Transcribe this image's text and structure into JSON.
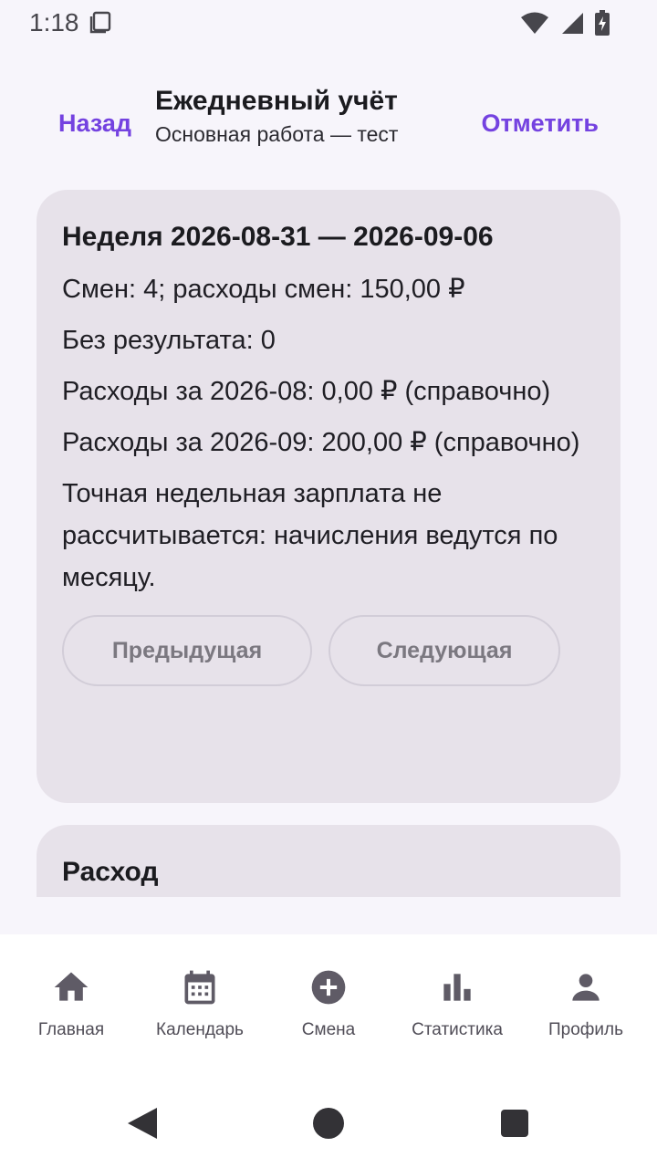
{
  "status_bar": {
    "time": "1:18"
  },
  "header": {
    "back_label": "Назад",
    "title": "Ежедневный учёт",
    "subtitle": "Основная работа — тест",
    "mark_label": "Отметить"
  },
  "week_card": {
    "title": "Неделя 2026-08-31 — 2026-09-06",
    "lines": [
      "Смен: 4; расходы смен: 150,00 ₽",
      "Без результата: 0",
      "Расходы за 2026-08: 0,00 ₽ (справочно)",
      "Расходы за 2026-09: 200,00 ₽ (справочно)",
      "Точная недельная зарплата не рассчитывается: начисления ведутся по месяцу."
    ],
    "prev_label": "Предыдущая",
    "next_label": "Следующая"
  },
  "expense_card": {
    "title": "Расход"
  },
  "bottom_nav": {
    "items": [
      {
        "label": "Главная",
        "icon": "home-icon"
      },
      {
        "label": "Календарь",
        "icon": "calendar-icon"
      },
      {
        "label": "Смена",
        "icon": "add-circle-icon"
      },
      {
        "label": "Статистика",
        "icon": "bar-chart-icon"
      },
      {
        "label": "Профиль",
        "icon": "person-icon"
      }
    ]
  },
  "colors": {
    "accent": "#7442e0",
    "card": "#e7e2ea",
    "background": "#f7f5fb",
    "icon": "#5f5b66"
  }
}
